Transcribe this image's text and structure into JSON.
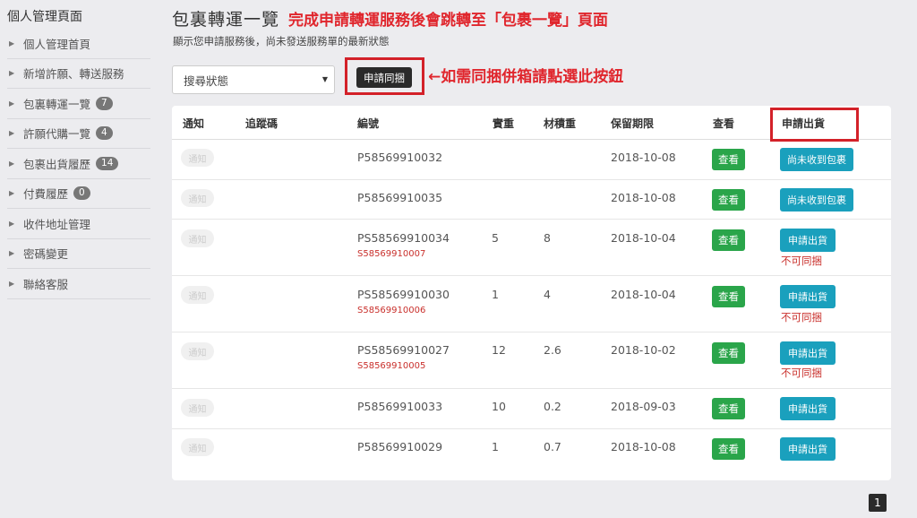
{
  "sidebar": {
    "title": "個人管理頁面",
    "items": [
      {
        "label": "個人管理首頁",
        "badge": ""
      },
      {
        "label": "新增許願、轉送服務",
        "badge": ""
      },
      {
        "label": "包裏轉運一覽",
        "badge": "7"
      },
      {
        "label": "許願代購一覽",
        "badge": "4"
      },
      {
        "label": "包裹出貨履歷",
        "badge": "14"
      },
      {
        "label": "付費履歷",
        "badge": "0"
      },
      {
        "label": "收件地址管理",
        "badge": ""
      },
      {
        "label": "密碼變更",
        "badge": ""
      },
      {
        "label": "聯絡客服",
        "badge": ""
      }
    ]
  },
  "header": {
    "title": "包裏轉運一覽",
    "note": "完成申請轉運服務後會跳轉至「包裹一覽」頁面",
    "subtitle": "顯示您申請服務後，尚未發送服務單的最新狀態"
  },
  "toolbar": {
    "search_select": "搜尋狀態",
    "merge_button": "申請同捆",
    "merge_note": "←如需同捆併箱請點選此按鈕"
  },
  "table": {
    "headers": {
      "notify": "通知",
      "tracking": "追蹤碼",
      "number": "編號",
      "weight": "實重",
      "volume": "材積重",
      "deadline": "保留期限",
      "view": "查看",
      "ship": "申請出貨"
    },
    "rows": [
      {
        "notify": "通知",
        "tracking": "",
        "number": "P58569910032",
        "sub": "",
        "weight": "",
        "volume": "",
        "deadline": "2018-10-08",
        "view": "查看",
        "ship": "尚未收到包裹",
        "nomerge": ""
      },
      {
        "notify": "通知",
        "tracking": "",
        "number": "P58569910035",
        "sub": "",
        "weight": "",
        "volume": "",
        "deadline": "2018-10-08",
        "view": "查看",
        "ship": "尚未收到包裹",
        "nomerge": ""
      },
      {
        "notify": "通知",
        "tracking": "",
        "number": "PS58569910034",
        "sub": "S58569910007",
        "weight": "5",
        "volume": "8",
        "deadline": "2018-10-04",
        "view": "查看",
        "ship": "申請出貨",
        "nomerge": "不可同捆"
      },
      {
        "notify": "通知",
        "tracking": "",
        "number": "PS58569910030",
        "sub": "S58569910006",
        "weight": "1",
        "volume": "4",
        "deadline": "2018-10-04",
        "view": "查看",
        "ship": "申請出貨",
        "nomerge": "不可同捆"
      },
      {
        "notify": "通知",
        "tracking": "",
        "number": "PS58569910027",
        "sub": "S58569910005",
        "weight": "12",
        "volume": "2.6",
        "deadline": "2018-10-02",
        "view": "查看",
        "ship": "申請出貨",
        "nomerge": "不可同捆"
      },
      {
        "notify": "通知",
        "tracking": "",
        "number": "P58569910033",
        "sub": "",
        "weight": "10",
        "volume": "0.2",
        "deadline": "2018-09-03",
        "view": "查看",
        "ship": "申請出貨",
        "nomerge": ""
      },
      {
        "notify": "通知",
        "tracking": "",
        "number": "P58569910029",
        "sub": "",
        "weight": "1",
        "volume": "0.7",
        "deadline": "2018-10-08",
        "view": "查看",
        "ship": "申請出貨",
        "nomerge": ""
      }
    ]
  },
  "pagination": {
    "current": "1"
  }
}
